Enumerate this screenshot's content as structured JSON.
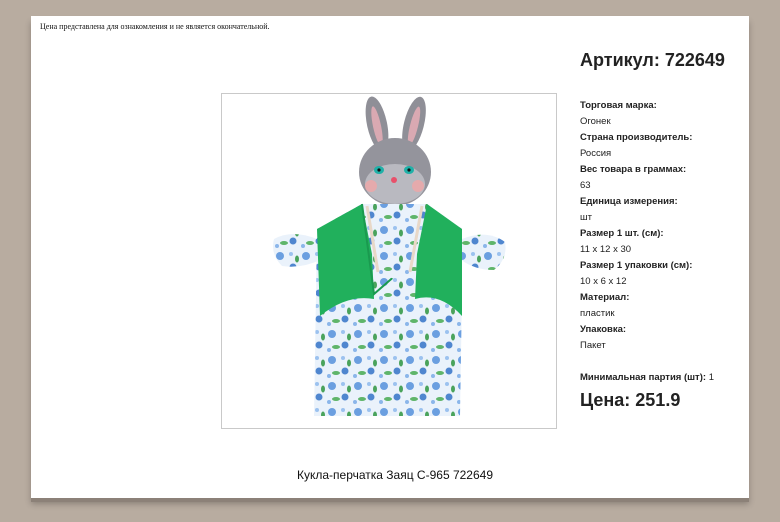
{
  "disclaimer": "Цена представлена для ознакомления и не является окончательной.",
  "article": {
    "label": "Артикул:",
    "value": "722649"
  },
  "specs": [
    {
      "label": "Торговая марка:",
      "value": "Огонек"
    },
    {
      "label": "Страна производитель:",
      "value": "Россия"
    },
    {
      "label": "Вес товара в граммах:",
      "value": "63"
    },
    {
      "label": "Единица измерения:",
      "value": "шт"
    },
    {
      "label": "Размер 1 шт. (см):",
      "value": "11 x 12 x 30"
    },
    {
      "label": "Размер 1 упаковки (см):",
      "value": "10 x 6 x 12"
    },
    {
      "label": "Материал:",
      "value": "пластик"
    },
    {
      "label": "Упаковка:",
      "value": "Пакет"
    }
  ],
  "min_order": {
    "label": "Минимальная партия (шт):",
    "value": "1"
  },
  "price": {
    "label": "Цена:",
    "value": "251.9"
  },
  "caption": "Кукла-перчатка Заяц С-965 722649",
  "colors": {
    "vest": "#1fae5a",
    "fabric": "#e8f1fb",
    "flower": "#5b93d6",
    "head": "#8e8e96"
  }
}
